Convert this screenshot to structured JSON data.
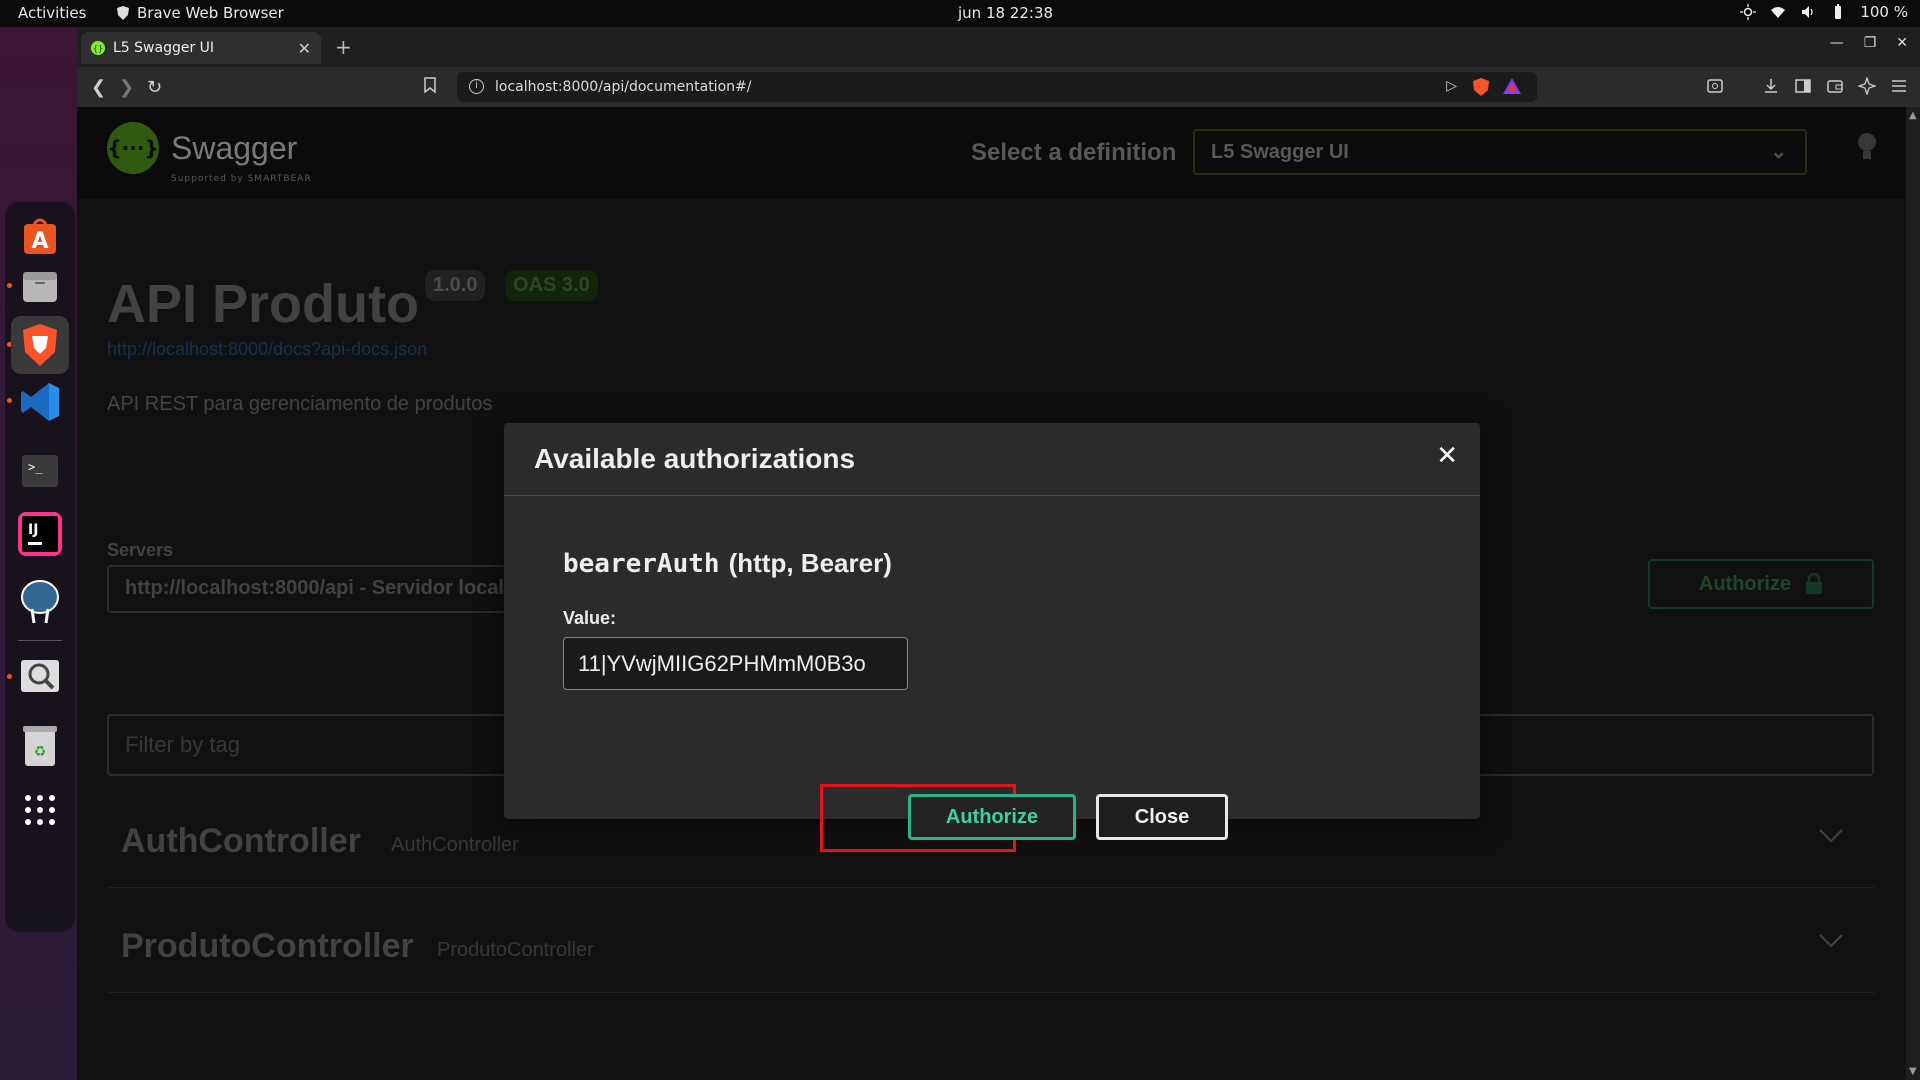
{
  "system": {
    "activities": "Activities",
    "app_name": "Brave Web Browser",
    "clock": "jun 18  22:38",
    "battery": "100 %"
  },
  "browser": {
    "tab_title": "L5 Swagger UI",
    "url": "localhost:8000/api/documentation#/"
  },
  "swagger": {
    "logo_text": "Swagger",
    "logo_sub": "Supported by SMARTBEAR",
    "select_label": "Select a definition",
    "select_value": "L5 Swagger UI",
    "title": "API Produto",
    "version": "1.0.0",
    "oas": "OAS 3.0",
    "docs_link": "http://localhost:8000/docs?api-docs.json",
    "description": "API REST para gerenciamento de produtos",
    "servers_label": "Servers",
    "server_value": "http://localhost:8000/api - Servidor local",
    "authorize_label": "Authorize",
    "filter_placeholder": "Filter by tag",
    "tags": [
      {
        "name": "AuthController",
        "desc": "AuthController"
      },
      {
        "name": "ProdutoController",
        "desc": "ProdutoController"
      }
    ]
  },
  "modal": {
    "title": "Available authorizations",
    "scheme_name": "bearerAuth",
    "scheme_type": "(http, Bearer)",
    "value_label": "Value:",
    "value": "11|YVwjMIIG62PHMmM0B3o",
    "authorize_label": "Authorize",
    "close_label": "Close"
  },
  "colors": {
    "accent_green": "#3fd39c",
    "highlight_red": "#e4141a",
    "input_border": "#5a8ad6"
  }
}
